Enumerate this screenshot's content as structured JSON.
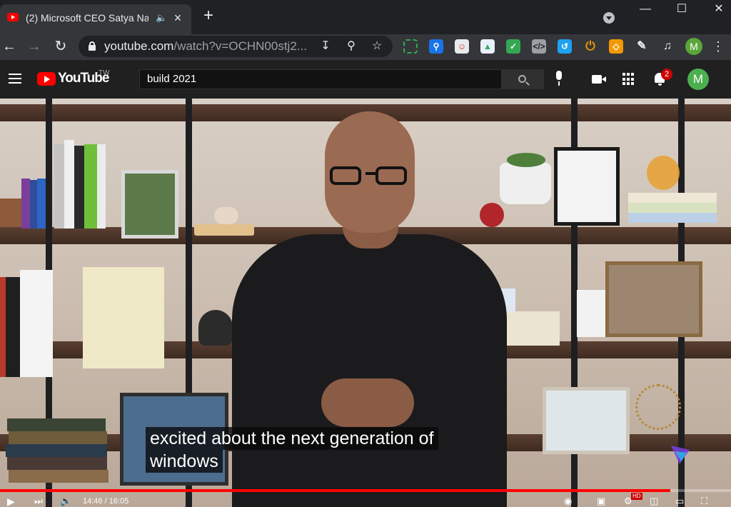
{
  "browser": {
    "tab_title": "(2) Microsoft CEO Satya Na",
    "new_tab_label": "+",
    "address": {
      "host": "youtube.com",
      "path": "/watch?v=OCHN00stj2..."
    },
    "profile_initial": "M",
    "window_controls": {
      "minimize": "—",
      "maximize": "☐",
      "close": "✕"
    }
  },
  "youtube": {
    "wordmark": "YouTube",
    "country_code": "TW",
    "search_value": "build 2021",
    "notifications_count": "2",
    "avatar_initial": "M"
  },
  "player": {
    "subtitle_line1": "excited about the next generation of",
    "subtitle_line2": "windows",
    "time_display": "14:46 / 16:05",
    "progress": 0.9166,
    "hd_badge": "HD"
  },
  "colors": {
    "youtube_red": "#ff0000",
    "chrome_dark": "#202124",
    "chrome_toolbar": "#35363a",
    "profile_green": "#5aa63a"
  },
  "icons": {
    "tab": [
      "youtube-favicon-icon",
      "audio-playing-icon",
      "close-tab-icon",
      "tab-search-icon"
    ],
    "toolbar": [
      "back-arrow-icon",
      "forward-arrow-icon",
      "reload-icon",
      "lock-icon",
      "download-icon",
      "zoom-icon",
      "bookmark-star-icon",
      "extensions-puzzle-icon",
      "media-control-icon",
      "menu-kebab-icon"
    ],
    "masthead": [
      "hamburger-menu-icon",
      "search-icon",
      "microphone-icon",
      "create-video-icon",
      "apps-grid-icon",
      "notifications-bell-icon"
    ]
  }
}
